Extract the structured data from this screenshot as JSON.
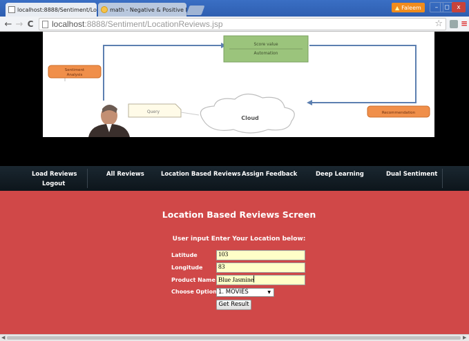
{
  "browser": {
    "tabs": [
      {
        "title": "localhost:8888/Sentiment/Lo",
        "close": "×",
        "active": true
      },
      {
        "title": "math - Negative & Positive F",
        "close": "×",
        "active": false
      }
    ],
    "profile_name": "Faleem",
    "window_controls": [
      "–",
      "◻",
      "x"
    ],
    "url_host": "localhost",
    "url_rest": ":8888/Sentiment/LocationReviews.jsp",
    "back": "←",
    "forward": "→",
    "reload": "C",
    "star": "☆",
    "menu": "≡"
  },
  "banner": {
    "top_box_line1": "Score value",
    "top_box_line2": "Automation",
    "left_box_line1": "Sentiment",
    "left_box_line2": "Analysis",
    "query_label": "Query",
    "cloud_label": "Cloud",
    "right_box_label": "Recommendation"
  },
  "nav": {
    "items": [
      "Load Reviews",
      "All Reviews",
      "Location Based Reviews",
      "Assign Feedback",
      "Deep Learning",
      "Dual Sentiment",
      "Logout"
    ]
  },
  "main": {
    "title": "Location Based Reviews Screen",
    "instructions": "User input Enter Your Location below:",
    "latitude_label": "Latitude",
    "latitude_value": "103",
    "longitude_label": "Longitude",
    "longitude_value": "83",
    "product_label": "Product Name",
    "product_value": "Blue Jasmine",
    "option_label": "Choose Option",
    "option_value": "1. MOVIES",
    "submit_label": "Get Result"
  },
  "colors": {
    "main_bg": "#d04848",
    "nav_bg": "#0d151b",
    "input_bg": "#ffffc8",
    "chrome_blue": "#3a6fc4",
    "profile": "#f08c1c"
  }
}
